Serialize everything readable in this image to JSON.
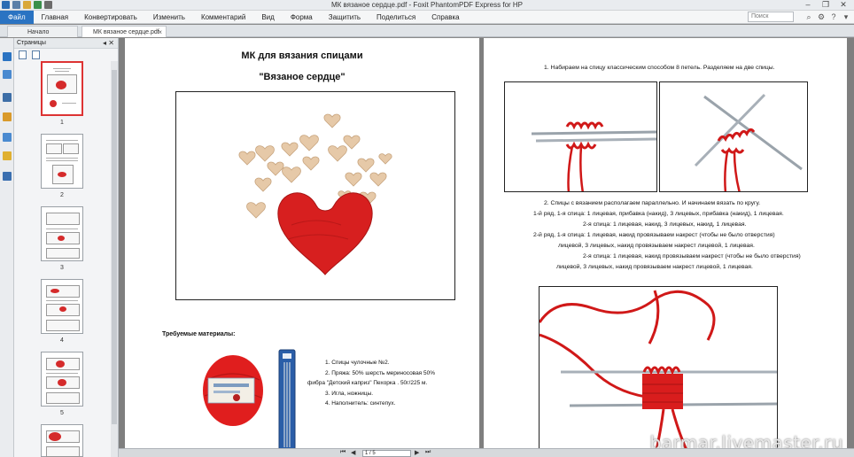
{
  "window": {
    "title": "МК вязаное сердце.pdf - Foxit PhantomPDF Express for HP",
    "controls": [
      "–",
      "❐",
      "✕"
    ]
  },
  "menu": {
    "file": "Файл",
    "items": [
      "Главная",
      "Конвертировать",
      "Изменить",
      "Комментарий",
      "Вид",
      "Форма",
      "Защитить",
      "Поделиться",
      "Справка"
    ],
    "search_placeholder": "Поиск"
  },
  "tabs": [
    {
      "label": "Начало"
    },
    {
      "label": "МК вязаное сердце.pdf"
    }
  ],
  "pages_panel": {
    "title": "Страницы",
    "thumbnails": [
      "1",
      "2",
      "3",
      "4",
      "5"
    ]
  },
  "page1": {
    "title": "МК для вязания спицами",
    "subtitle": "\"Вязаное сердце\"",
    "materials_title": "Требуемые материалы:",
    "materials": [
      "1.   Спицы чулочные №2.",
      "2.   Пряжа: 50% шерсть мериносовая 50%",
      "фибра \"Детский каприз\" Пехорка . 50г/225 м.",
      "3.   Игла, ножницы.",
      "4.   Наполнитель: синтепух."
    ]
  },
  "page2": {
    "step1": "1.   Набираем на спицу классическим способом 8 петель. Разделяем на две спицы.",
    "step2": "2.   Спицы с вязанием располагаем параллельно. И начинаем вязать по кругу.",
    "row1a": "1-й ряд, 1-я спица: 1 лицевая, прибавка (накид), 3 лицевых, прибавка (накид), 1 лицевая.",
    "row1b": "2-я спица: 1 лицевая, накид, 3 лицевых, накид, 1 лицевая.",
    "row2a": "2-й ряд, 1-я спица: 1 лицевая, накид провязываем накрест (чтобы не было отверстия)",
    "row2b": "лицевой, 3 лицевых, накид провязываем накрест лицевой, 1 лицевая.",
    "row2c": "2-я спица: 1 лицевая, накид провязываем накрест (чтобы не было отверстия)",
    "row2d": "лицевой, 3 лицевых, накид провязываем накрест лицевой, 1 лицевая."
  },
  "status": {
    "page_indicator": "1 / 5"
  },
  "watermark": "barmar.livemaster.ru",
  "colors": {
    "accent": "#2a73c2",
    "yarn": "#d92020"
  }
}
